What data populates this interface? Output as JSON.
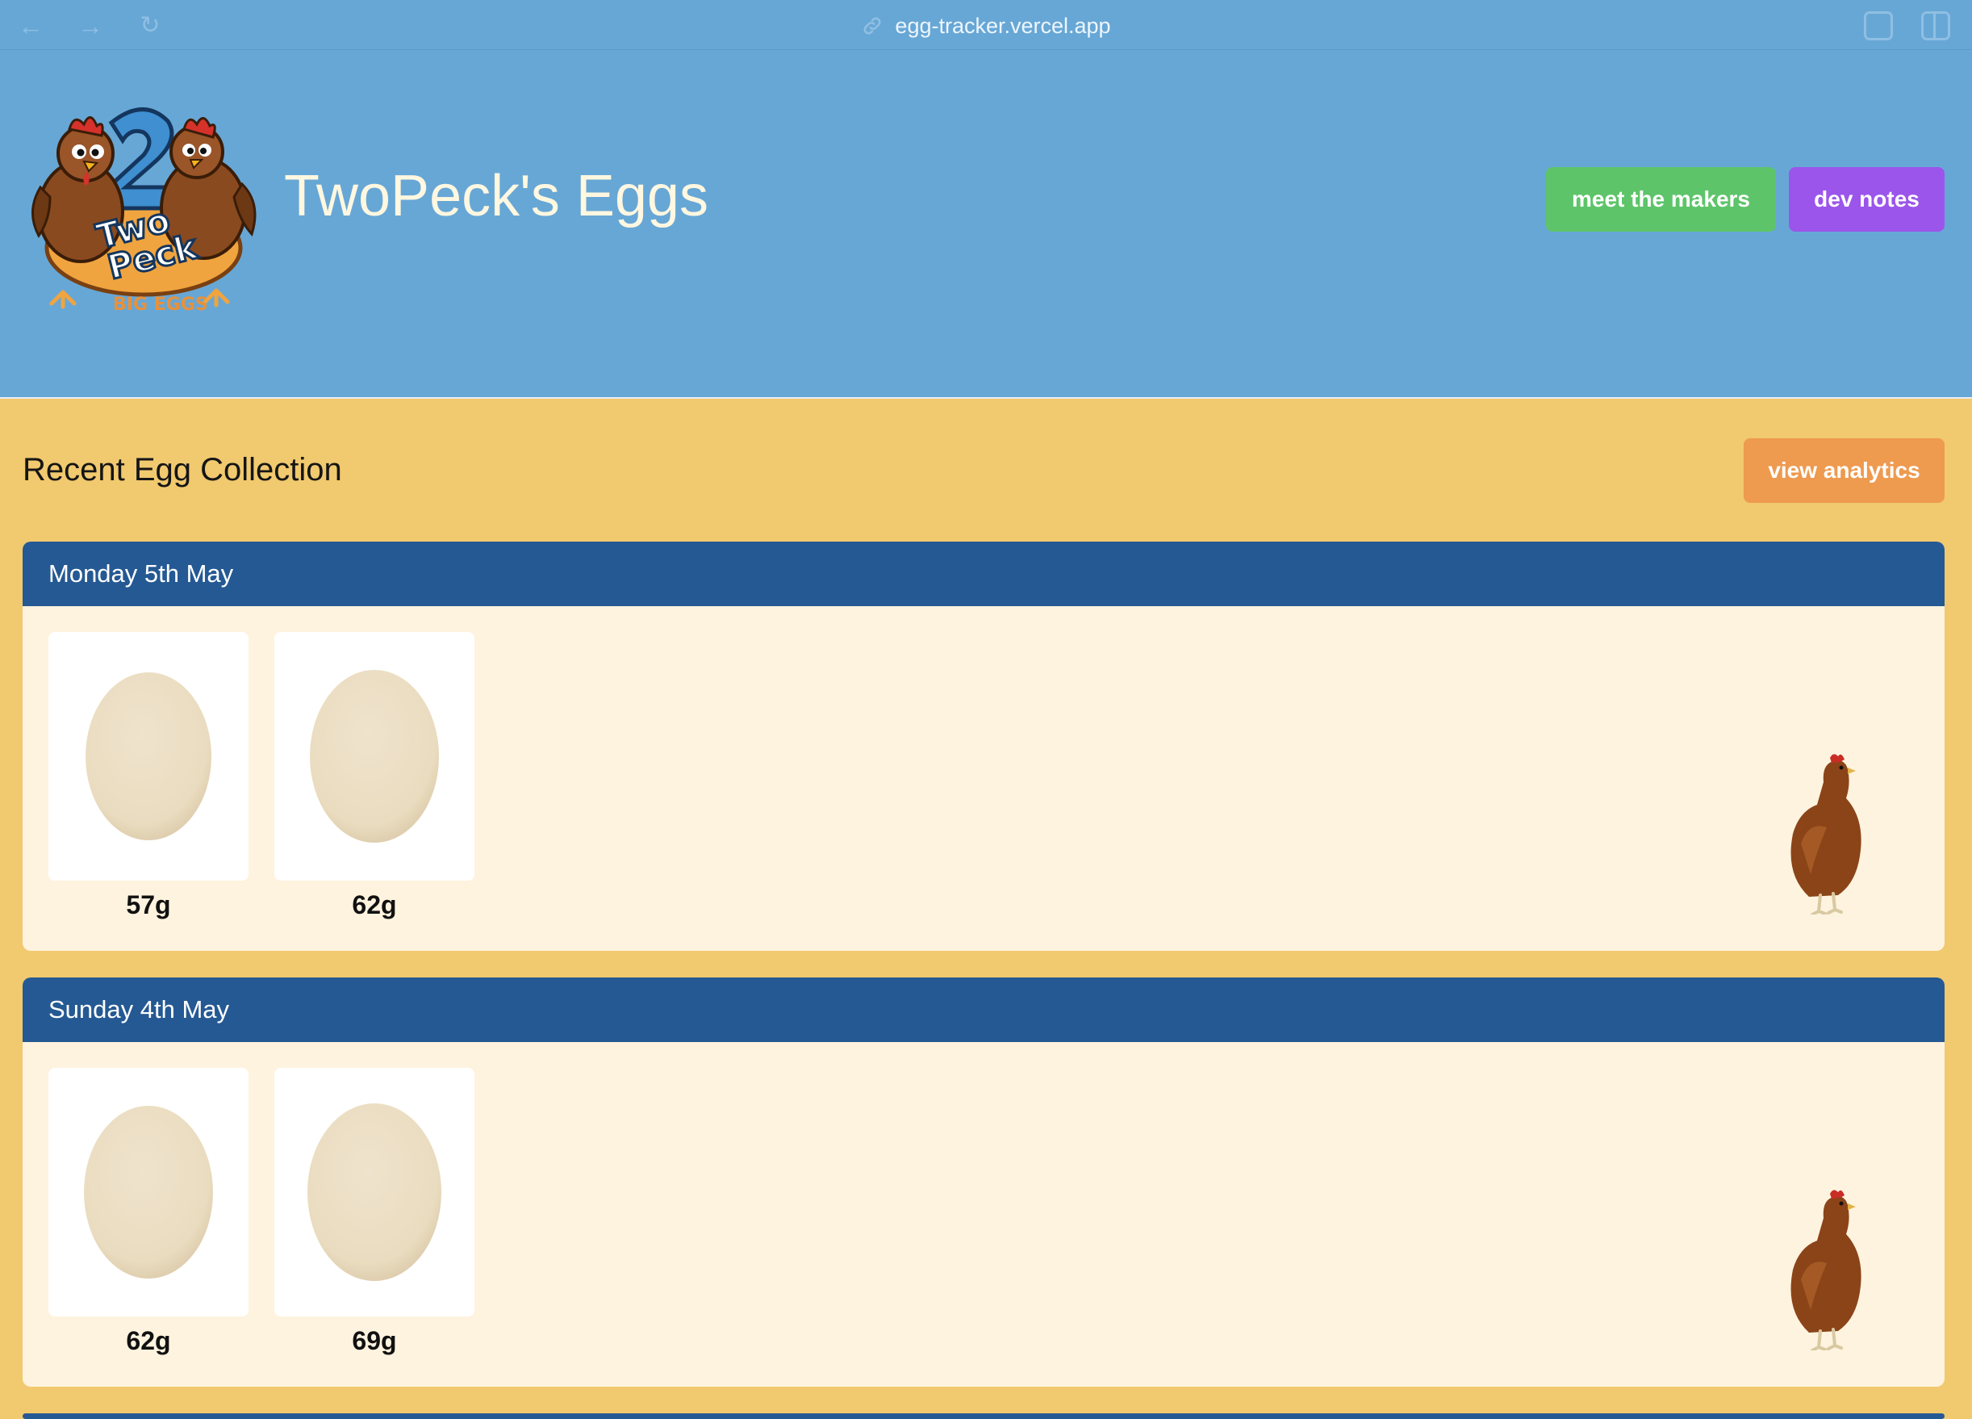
{
  "browser": {
    "url": "egg-tracker.vercel.app",
    "back_icon": "arrow-left-icon",
    "forward_icon": "arrow-right-icon",
    "reload_icon": "reload-icon"
  },
  "header": {
    "title": "TwoPeck's Eggs",
    "logo": {
      "line1": "Two",
      "line2": "Peck",
      "tagline": "BIG EGGS",
      "number": "2"
    },
    "buttons": {
      "makers": "meet the makers",
      "notes": "dev notes"
    }
  },
  "main": {
    "title": "Recent Egg Collection",
    "analytics_label": "view analytics",
    "days": [
      {
        "label": "Monday 5th May",
        "eggs": [
          {
            "weight": "57g"
          },
          {
            "weight": "62g"
          }
        ]
      },
      {
        "label": "Sunday 4th May",
        "eggs": [
          {
            "weight": "62g"
          },
          {
            "weight": "69g"
          }
        ]
      }
    ]
  },
  "colors": {
    "header_bg": "#67a7d6",
    "page_bg": "#f1c96e",
    "day_header": "#255993",
    "card_bg": "#fef3df",
    "makers_btn": "#5ec46a",
    "notes_btn": "#9b55ea",
    "analytics_btn": "#ee9a4f"
  }
}
